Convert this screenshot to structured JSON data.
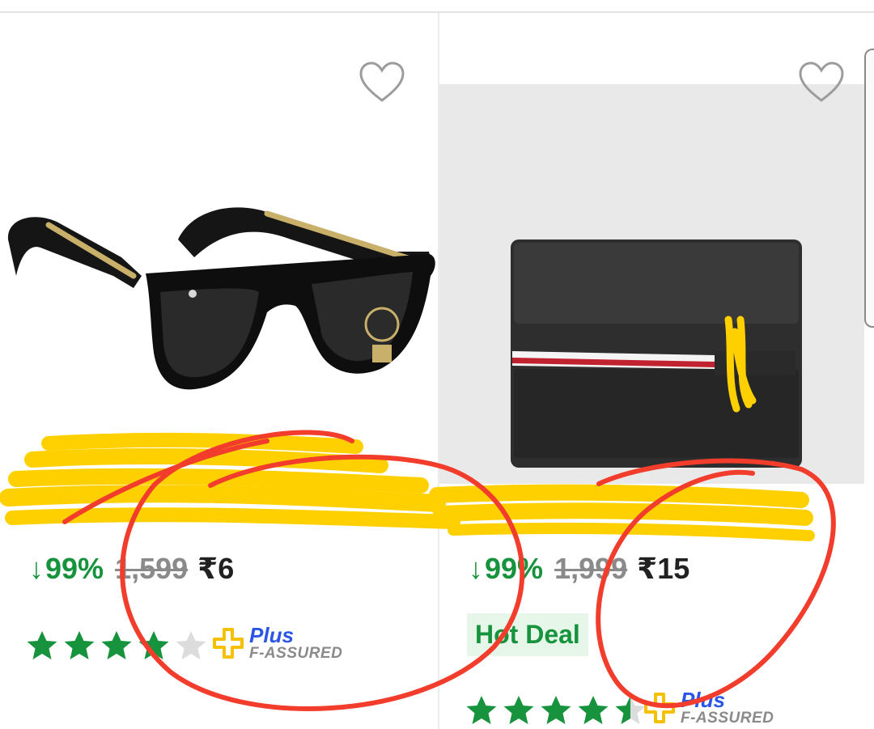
{
  "products": [
    {
      "product_image": "sunglasses-image",
      "discount": "99%",
      "mrp": "1,599",
      "price": "₹6",
      "rating_stars": 4,
      "assured_plus": "Plus",
      "assured_label": "F-ASSURED"
    },
    {
      "product_image": "wallet-image",
      "discount": "99%",
      "mrp": "1,999",
      "price": "₹15",
      "badge": "Hot Deal",
      "rating_stars": 4.5,
      "assured_plus": "Plus",
      "assured_label": "F-ASSURED"
    }
  ],
  "icons": {
    "wishlist": "heart-outline-icon",
    "discount_arrow": "arrow-down-icon",
    "rating": "star-icon",
    "assured": "plus-assured-icon"
  },
  "colors": {
    "discount_green": "#17933d",
    "star_green": "#17933d",
    "plus_blue": "#2a55e5",
    "highlight_yellow": "#ffd000",
    "annotation_red": "#f23c2c"
  }
}
